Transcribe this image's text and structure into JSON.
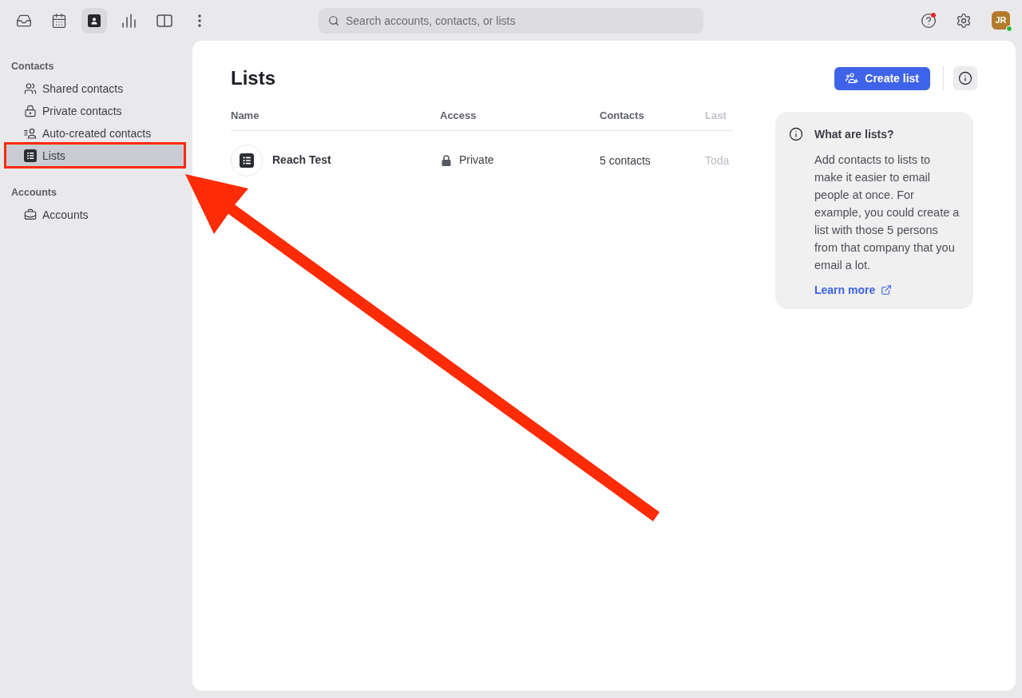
{
  "toolbar": {
    "apps": [
      {
        "kind": "inbox",
        "selected": false
      },
      {
        "kind": "calendar",
        "selected": false
      },
      {
        "kind": "contacts",
        "selected": true
      },
      {
        "kind": "reports",
        "selected": false
      },
      {
        "kind": "panel",
        "selected": false
      },
      {
        "kind": "more",
        "selected": false
      }
    ]
  },
  "search": {
    "placeholder": "Search accounts, contacts, or lists"
  },
  "help": {
    "notification": true
  },
  "profile": {
    "initials": "JR",
    "online": true
  },
  "sidebar": {
    "sections": [
      {
        "heading": "Contacts",
        "items": [
          {
            "label": "Shared contacts",
            "kind": "shared",
            "selected": false
          },
          {
            "label": "Private contacts",
            "kind": "private",
            "selected": false
          },
          {
            "label": "Auto-created contacts",
            "kind": "auto",
            "selected": false
          },
          {
            "label": "Lists",
            "kind": "lists",
            "selected": true
          }
        ]
      },
      {
        "heading": "Accounts",
        "items": [
          {
            "label": "Accounts",
            "kind": "accounts",
            "selected": false
          }
        ]
      }
    ]
  },
  "main": {
    "title": "Lists",
    "create_button": "Create list",
    "table": {
      "columns": [
        "Name",
        "Access",
        "Contacts",
        "Last"
      ],
      "rows": [
        {
          "cells": [
            "Reach Test",
            "Private",
            "5 contacts",
            "Toda"
          ]
        }
      ]
    },
    "info_card": {
      "title": "What are lists?",
      "text": "Add contacts to lists to make it easier to email people at once. For example, you could create a list with those 5 persons from that company that you email a lot.",
      "link": "Learn more"
    }
  }
}
